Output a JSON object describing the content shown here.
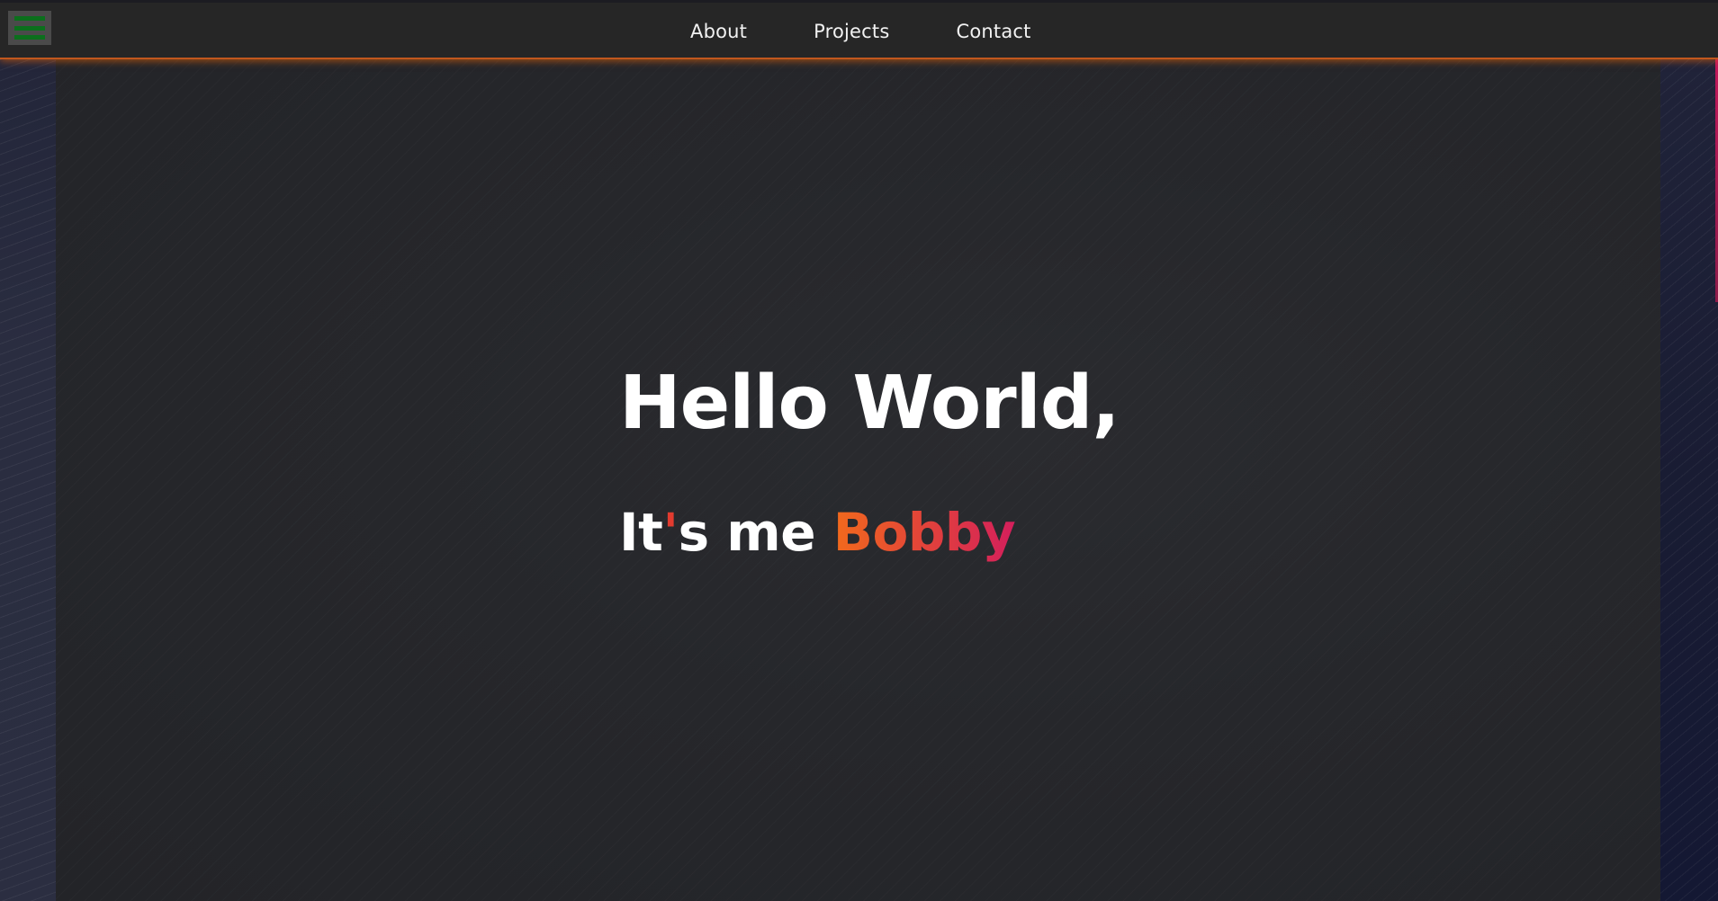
{
  "nav": {
    "items": [
      {
        "label": "About"
      },
      {
        "label": "Projects"
      },
      {
        "label": "Contact"
      }
    ],
    "menu_icon": "hamburger-menu-icon"
  },
  "hero": {
    "title": "Hello World,",
    "subtitle_prefix_1": "It",
    "subtitle_apostrophe": "'",
    "subtitle_prefix_2": "s me ",
    "name": "Bobby"
  },
  "colors": {
    "accent_orange": "#f26a1c",
    "accent_pink": "#d41f5c",
    "menu_icon_green": "#0b6f1c",
    "navbar_bg": "#262626",
    "content_bg": "#26272b"
  }
}
